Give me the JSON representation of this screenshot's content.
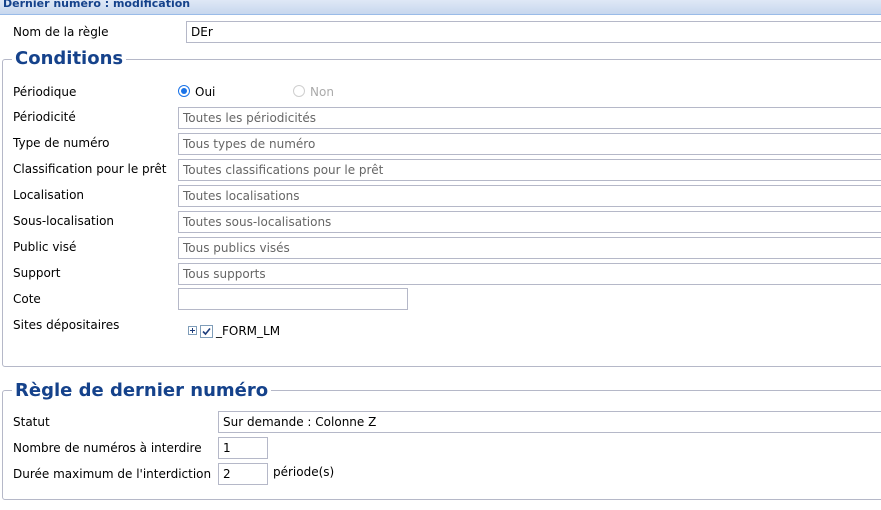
{
  "window": {
    "title": "Dernier numéro : modification"
  },
  "rule_name": {
    "label": "Nom de la règle",
    "value": "DEr"
  },
  "conditions": {
    "legend": "Conditions",
    "periodique": {
      "label": "Périodique",
      "options": [
        "Oui",
        "Non"
      ],
      "selected": "Oui"
    },
    "periodicite": {
      "label": "Périodicité",
      "placeholder": "Toutes les périodicités"
    },
    "type_numero": {
      "label": "Type de numéro",
      "placeholder": "Tous types de numéro"
    },
    "classification": {
      "label": "Classification pour le prêt",
      "placeholder": "Toutes classifications pour le prêt"
    },
    "localisation": {
      "label": "Localisation",
      "placeholder": "Toutes localisations"
    },
    "sous_localisation": {
      "label": "Sous-localisation",
      "placeholder": "Toutes sous-localisations"
    },
    "public_vise": {
      "label": "Public visé",
      "placeholder": "Tous publics visés"
    },
    "support": {
      "label": "Support",
      "placeholder": "Tous supports"
    },
    "cote": {
      "label": "Cote",
      "value": ""
    },
    "sites": {
      "label": "Sites dépositaires",
      "tree": [
        {
          "label": "_FORM_LM",
          "checked": true
        }
      ]
    }
  },
  "regle": {
    "legend": "Règle de dernier numéro",
    "statut": {
      "label": "Statut",
      "value": "Sur demande : Colonne Z"
    },
    "nombre": {
      "label": "Nombre de numéros à interdire",
      "value": "1"
    },
    "duree": {
      "label": "Durée maximum de l'interdiction",
      "value": "2",
      "unit": "période(s)"
    }
  },
  "colors": {
    "title_text": "#15428b",
    "legend_text": "#15428b",
    "border": "#b5b8c8",
    "radio_accent": "#1a73e8"
  }
}
